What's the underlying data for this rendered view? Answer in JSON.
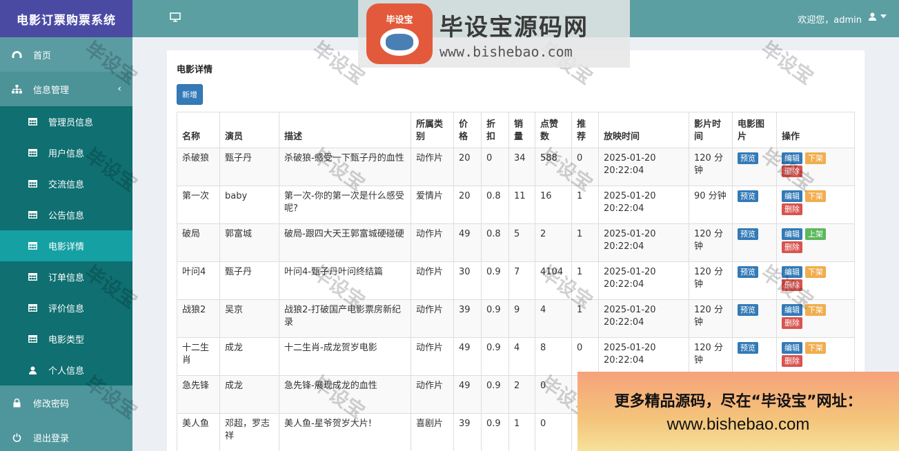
{
  "brand": "电影订票购票系统",
  "topbar": {
    "welcome": "欢迎您，admin"
  },
  "menu": {
    "home": "首页",
    "info_mgmt": "信息管理",
    "sub_items": [
      "管理员信息",
      "用户信息",
      "交流信息",
      "公告信息",
      "电影详情",
      "订单信息",
      "评价信息",
      "电影类型",
      "个人信息"
    ],
    "change_password": "修改密码",
    "logout": "退出登录"
  },
  "panel": {
    "title": "电影详情",
    "add_label": "新增"
  },
  "table": {
    "headers": [
      "名称",
      "演员",
      "描述",
      "所属类别",
      "价格",
      "折扣",
      "销量",
      "点赞数",
      "推荐",
      "放映时间",
      "影片时间",
      "电影图片",
      "操作"
    ],
    "rows": [
      [
        "杀破狼",
        "甄子丹",
        "杀破狼-感受一下甄子丹的血性",
        "动作片",
        "20",
        "0",
        "34",
        "588",
        "0",
        "2025-01-20 20:22:04",
        "120 分钟",
        "预览",
        "编辑",
        "下架",
        "删除"
      ],
      [
        "第一次",
        "baby",
        "第一次-你的第一次是什么感受呢?",
        "爱情片",
        "20",
        "0.8",
        "11",
        "16",
        "1",
        "2025-01-20 20:22:04",
        "90 分钟",
        "预览",
        "编辑",
        "下架",
        "删除"
      ],
      [
        "破局",
        "郭富城",
        "破局-跟四大天王郭富城硬碰硬",
        "动作片",
        "49",
        "0.8",
        "5",
        "2",
        "1",
        "2025-01-20 20:22:04",
        "120 分钟",
        "预览",
        "编辑",
        "上架",
        "删除"
      ],
      [
        "叶问4",
        "甄子丹",
        "叶问4-甄子丹叶问终结篇",
        "动作片",
        "30",
        "0.9",
        "7",
        "4104",
        "1",
        "2025-01-20 20:22:04",
        "120 分钟",
        "预览",
        "编辑",
        "下架",
        "删除"
      ],
      [
        "战狼2",
        "吴京",
        "战狼2-打破国产电影票房新纪录",
        "动作片",
        "39",
        "0.9",
        "9",
        "4",
        "1",
        "2025-01-20 20:22:04",
        "120 分钟",
        "预览",
        "编辑",
        "下架",
        "删除"
      ],
      [
        "十二生肖",
        "成龙",
        "十二生肖-成龙贺岁电影",
        "动作片",
        "49",
        "0.9",
        "4",
        "8",
        "0",
        "2025-01-20 20:22:04",
        "120 分钟",
        "预览",
        "编辑",
        "下架",
        "删除"
      ],
      [
        "急先锋",
        "成龙",
        "急先锋-展现成龙的血性",
        "动作片",
        "49",
        "0.9",
        "2",
        "0",
        "",
        "",
        "",
        "",
        "",
        "",
        ""
      ],
      [
        "美人鱼",
        "邓超，罗志祥",
        "美人鱼-星爷贺岁大片!",
        "喜剧片",
        "39",
        "0.9",
        "1",
        "0",
        "",
        "",
        "",
        "",
        "",
        "",
        ""
      ]
    ]
  },
  "overlay": {
    "logo_badge": "毕设宝",
    "logo_main": "毕设宝源码网",
    "logo_url": "www.bishebao.com",
    "promo_line1": "更多精品源码，尽在“毕设宝”网址：",
    "promo_line2": "www.bishebao.com",
    "watermark": "毕设宝"
  }
}
